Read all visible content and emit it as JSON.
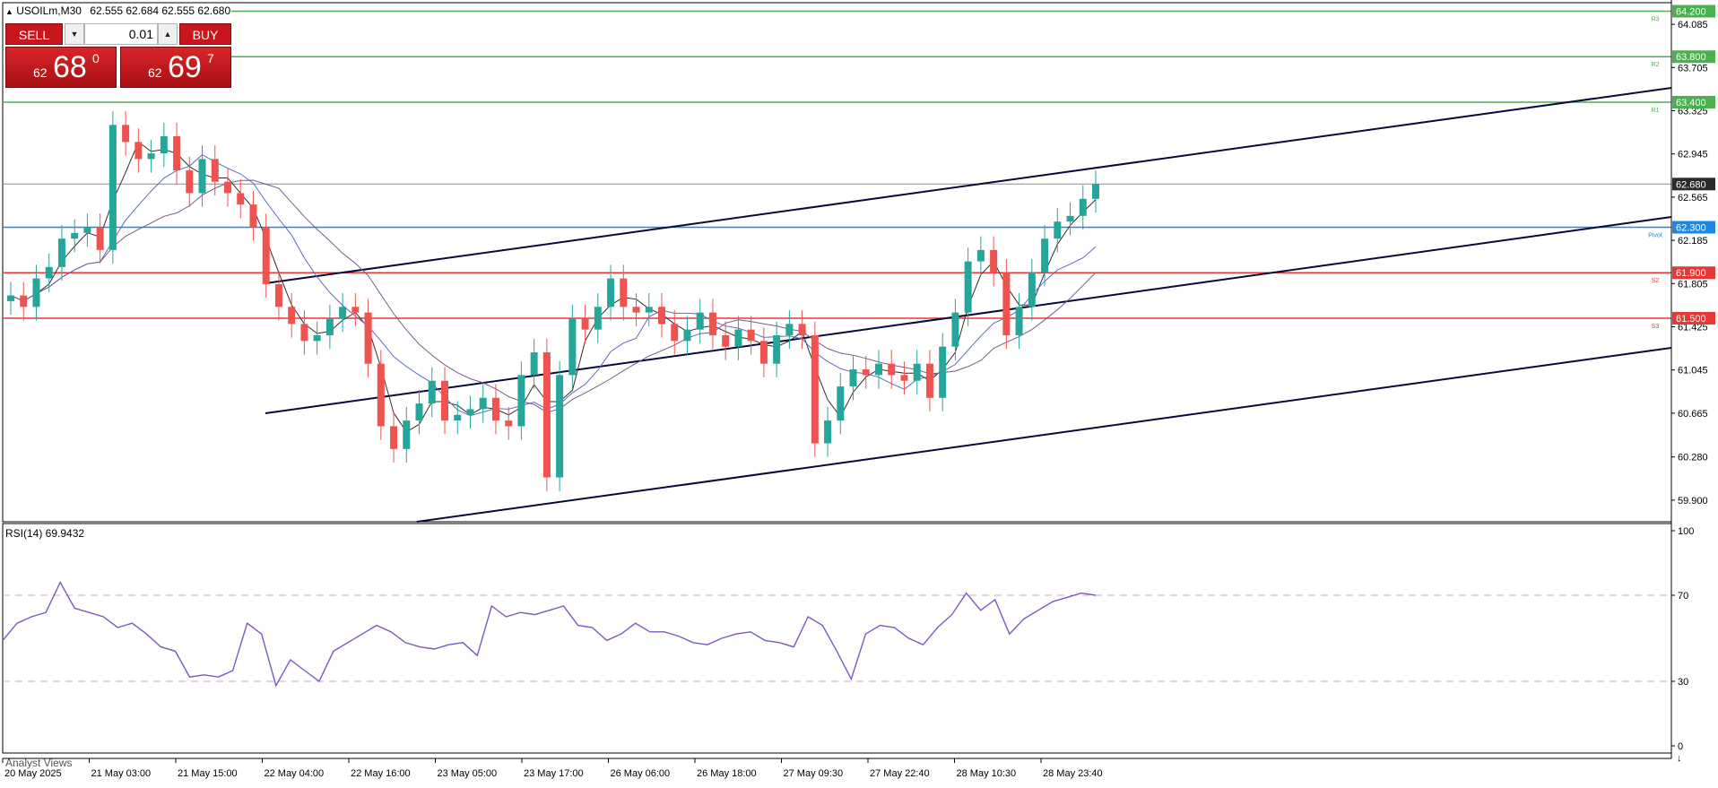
{
  "header": {
    "symbol_line": "USOILm,M30",
    "ohlc": "62.555 62.684 62.555 62.680"
  },
  "trade_panel": {
    "sell_label": "SELL",
    "buy_label": "BUY",
    "lot_value": "0.01",
    "sell_prefix": "62",
    "sell_big": "68",
    "sell_sup": "0",
    "buy_prefix": "62",
    "buy_big": "69",
    "buy_sup": "7"
  },
  "indicator_label": "RSI(14) 69.9432",
  "footer_label": "Analyst Views",
  "colors": {
    "bull": "#26a69a",
    "bear": "#ef5350",
    "resistance": "#4caf50",
    "support": "#e53935",
    "pivot": "#1e88e5",
    "channel": "#0a0a3a",
    "rsi": "#7e57c2",
    "ma1": "#3a2a2a",
    "ma2": "#5c6bc0",
    "ma3": "#7b5a8a"
  },
  "chart_data": [
    {
      "type": "candlestick",
      "timeframe": "M30",
      "ylim": [
        59.71,
        64.275
      ],
      "y_ticks": [
        "64.085",
        "63.705",
        "63.325",
        "62.945",
        "62.565",
        "62.185",
        "61.805",
        "61.425",
        "61.045",
        "60.665",
        "60.280",
        "59.900"
      ],
      "x_ticks": [
        "20 May 2025",
        "21 May 03:00",
        "21 May 15:00",
        "22 May 04:00",
        "22 May 16:00",
        "23 May 05:00",
        "23 May 17:00",
        "26 May 06:00",
        "26 May 18:00",
        "27 May 09:30",
        "27 May 22:40",
        "28 May 10:30",
        "28 May 23:40"
      ],
      "close_series": [
        61.7,
        61.6,
        61.85,
        61.95,
        62.2,
        62.25,
        62.3,
        62.1,
        63.2,
        63.05,
        62.9,
        62.95,
        63.1,
        62.8,
        62.6,
        62.9,
        62.7,
        62.6,
        62.5,
        62.3,
        61.8,
        61.6,
        61.45,
        61.3,
        61.35,
        61.5,
        61.6,
        61.55,
        61.1,
        60.55,
        60.35,
        60.6,
        60.75,
        60.95,
        60.6,
        60.65,
        60.7,
        60.8,
        60.6,
        60.55,
        61.0,
        61.2,
        60.1,
        61.0,
        61.5,
        61.4,
        61.6,
        61.85,
        61.6,
        61.55,
        61.6,
        61.45,
        61.3,
        61.4,
        61.55,
        61.35,
        61.25,
        61.4,
        61.3,
        61.1,
        61.35,
        61.45,
        61.35,
        60.4,
        60.6,
        60.9,
        61.05,
        61.0,
        61.1,
        61.0,
        60.95,
        61.1,
        60.8,
        61.25,
        61.55,
        62.0,
        62.1,
        61.9,
        61.35,
        61.6,
        61.9,
        62.2,
        62.35,
        62.4,
        62.55,
        62.68
      ],
      "rsi": [
        49,
        57,
        60,
        62,
        76,
        64,
        62,
        60,
        55,
        57,
        52,
        46,
        44,
        32,
        33,
        32,
        35,
        57,
        52,
        28,
        40,
        35,
        30,
        44,
        48,
        52,
        56,
        53,
        48,
        46,
        45,
        47,
        48,
        42,
        65,
        60,
        62,
        61,
        63,
        65,
        56,
        55,
        49,
        52,
        57,
        53,
        53,
        51,
        48,
        47,
        50,
        52,
        53,
        49,
        48,
        46,
        60,
        56,
        44,
        31,
        52,
        56,
        55,
        50,
        47,
        55,
        61,
        71,
        63,
        68,
        52,
        59,
        63,
        67,
        69,
        71,
        70
      ],
      "rsi_levels": [
        70,
        30
      ],
      "rsi_ylim": [
        0,
        100
      ],
      "rsi_ticks": [
        "100",
        "70",
        "30",
        "0"
      ]
    }
  ],
  "levels": [
    {
      "value": 64.2,
      "label": "64.200",
      "tag": "R3",
      "kind": "resistance"
    },
    {
      "value": 63.8,
      "label": "63.800",
      "tag": "R2",
      "kind": "resistance"
    },
    {
      "value": 63.4,
      "label": "63.400",
      "tag": "R1",
      "kind": "resistance"
    },
    {
      "value": 62.3,
      "label": "62.300",
      "tag": "Pivot",
      "kind": "pivot"
    },
    {
      "value": 61.9,
      "label": "61.900",
      "tag": "S2",
      "kind": "support"
    },
    {
      "value": 61.5,
      "label": "61.500",
      "tag": "S3",
      "kind": "support"
    }
  ],
  "current_price": {
    "value": 62.68,
    "label": "62.680"
  }
}
